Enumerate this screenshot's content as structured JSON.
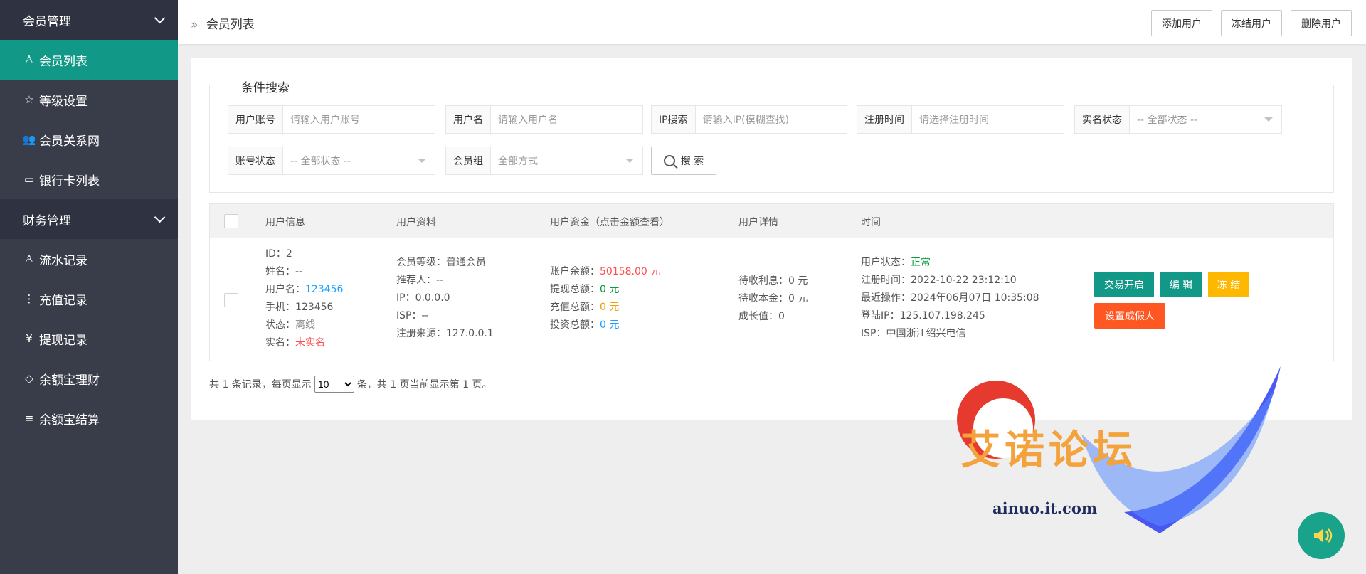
{
  "sidebar": {
    "groups": [
      {
        "label": "会员管理",
        "icon": "chevron-down-icon"
      },
      {
        "label": "财务管理",
        "icon": "chevron-down-icon"
      }
    ],
    "items": [
      {
        "label": "会员列表",
        "icon": "user-icon",
        "glyph": "♙",
        "active": true
      },
      {
        "label": "等级设置",
        "icon": "star-icon",
        "glyph": "☆"
      },
      {
        "label": "会员关系网",
        "icon": "users-icon",
        "glyph": "👥"
      },
      {
        "label": "银行卡列表",
        "icon": "credit-card-icon",
        "glyph": "▭"
      },
      {
        "label": "流水记录",
        "icon": "user-icon",
        "glyph": "♙"
      },
      {
        "label": "充值记录",
        "icon": "more-vertical-icon",
        "glyph": "⋮"
      },
      {
        "label": "提现记录",
        "icon": "yen-icon",
        "glyph": "¥"
      },
      {
        "label": "余额宝理财",
        "icon": "diamond-icon",
        "glyph": "◇"
      },
      {
        "label": "余额宝结算",
        "icon": "server-icon",
        "glyph": "≡"
      }
    ]
  },
  "header": {
    "breadcrumb_arrow": "»",
    "title": "会员列表",
    "buttons": [
      "添加用户",
      "冻结用户",
      "删除用户"
    ]
  },
  "search": {
    "legend": "条件搜索",
    "fields": [
      {
        "label": "用户账号",
        "placeholder": "请输入用户账号"
      },
      {
        "label": "用户名",
        "placeholder": "请输入用户名"
      },
      {
        "label": "IP搜索",
        "placeholder": "请输入IP(模糊查找)"
      },
      {
        "label": "注册时间",
        "placeholder": "请选择注册时间"
      },
      {
        "label": "实名状态",
        "placeholder": "-- 全部状态 --"
      },
      {
        "label": "账号状态",
        "placeholder": "-- 全部状态 --"
      },
      {
        "label": "会员组",
        "placeholder": "全部方式"
      }
    ],
    "button": "搜 索"
  },
  "table": {
    "headers": [
      "用户信息",
      "用户资料",
      "用户资金（点击金额查看）",
      "用户详情",
      "时间"
    ],
    "row": {
      "info": {
        "id": "ID：2",
        "name": "姓名：--",
        "username_label": "用户名：",
        "username": "123456",
        "phone": "手机：123456",
        "status_label": "状态：",
        "status": "离线",
        "realname_label": "实名：",
        "realname": "未实名"
      },
      "profile": {
        "level": "会员等级：普通会员",
        "referrer": "推荐人：--",
        "ip": "IP：0.0.0.0",
        "isp": "ISP：--",
        "source": "注册来源：127.0.0.1"
      },
      "funds": {
        "balance_label": "账户余额：",
        "balance": "50158.00 元",
        "withdraw_label": "提现总额：",
        "withdraw": "0 元",
        "recharge_label": "充值总额：",
        "recharge": "0 元",
        "invest_label": "投资总额：",
        "invest": "0 元"
      },
      "details": {
        "interest": "待收利息：0 元",
        "principal": "待收本金：0 元",
        "growth": "成长值：0"
      },
      "time": {
        "state_label": "用户状态：",
        "state": "正常",
        "registered": "注册时间：2022-10-22 23:12:10",
        "last_op": "最近操作：2024年06月07日 10:35:08",
        "login_ip": "登陆IP：125.107.198.245",
        "isp": "ISP：中国浙江绍兴电信"
      },
      "actions": [
        {
          "label": "交易开启",
          "color": "#119887"
        },
        {
          "label": "编 辑",
          "color": "#119887"
        },
        {
          "label": "冻 结",
          "color": "#ffb800"
        },
        {
          "label": "设置成假人",
          "color": "#ff5722"
        }
      ]
    }
  },
  "pager": {
    "prefix": "共 1 条记录，每页显示",
    "page_size": "10",
    "suffix": "条，共 1 页当前显示第 1 页。"
  },
  "watermark": {
    "title": "艾诺论坛",
    "domain": "ainuo.it.com"
  },
  "colors": {
    "sidebar_bg": "#393d49",
    "active": "#119887",
    "danger": "#ff5722",
    "warn": "#ffb800"
  }
}
